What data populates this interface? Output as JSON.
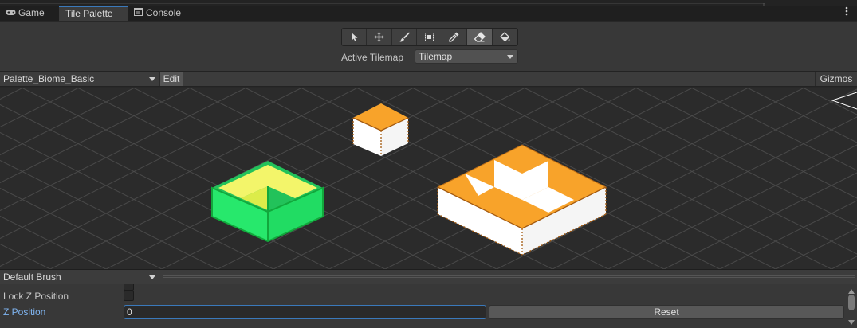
{
  "tabs": [
    {
      "id": "game",
      "label": "Game",
      "icon": "gamepad-icon",
      "active": false
    },
    {
      "id": "tile-palette",
      "label": "Tile Palette",
      "icon": "",
      "active": true
    },
    {
      "id": "console",
      "label": "Console",
      "icon": "console-icon",
      "active": false
    }
  ],
  "toolbar": {
    "tools": [
      {
        "name": "select",
        "icon": "cursor-arrow-icon",
        "selected": false
      },
      {
        "name": "move",
        "icon": "move-arrows-icon",
        "selected": false
      },
      {
        "name": "paint",
        "icon": "brush-icon",
        "selected": false
      },
      {
        "name": "box-fill",
        "icon": "box-fill-icon",
        "selected": false
      },
      {
        "name": "pick",
        "icon": "eyedropper-icon",
        "selected": false
      },
      {
        "name": "erase",
        "icon": "eraser-icon",
        "selected": true
      },
      {
        "name": "fill",
        "icon": "paint-bucket-icon",
        "selected": false
      }
    ],
    "active_tilemap_label": "Active Tilemap",
    "active_tilemap_value": "Tilemap"
  },
  "palette": {
    "selected": "Palette_Biome_Basic",
    "edit_label": "Edit",
    "gizmos_label": "Gizmos"
  },
  "scene": {
    "tiles": [
      {
        "name": "grass-tile",
        "top_color": "#f3f56a",
        "side_color": "#27e86c",
        "outline_color": "#12a83c"
      },
      {
        "name": "small-orange-tile",
        "top_color": "#f8a32a",
        "side_color": "#ffffff"
      },
      {
        "name": "large-orange-tile",
        "top_color": "#f8a32a",
        "side_color": "#ffffff"
      }
    ]
  },
  "brush": {
    "selected": "Default Brush",
    "rows": [
      {
        "label": "Lock Z Position",
        "type": "checkbox",
        "checked": false
      },
      {
        "label": "Z Position",
        "type": "text",
        "value": "0",
        "button": "Reset"
      }
    ]
  },
  "colors": {
    "accent": "#3a79bb",
    "grid_line": "#4a4a4a",
    "scene_background": "#2b2b2b"
  }
}
